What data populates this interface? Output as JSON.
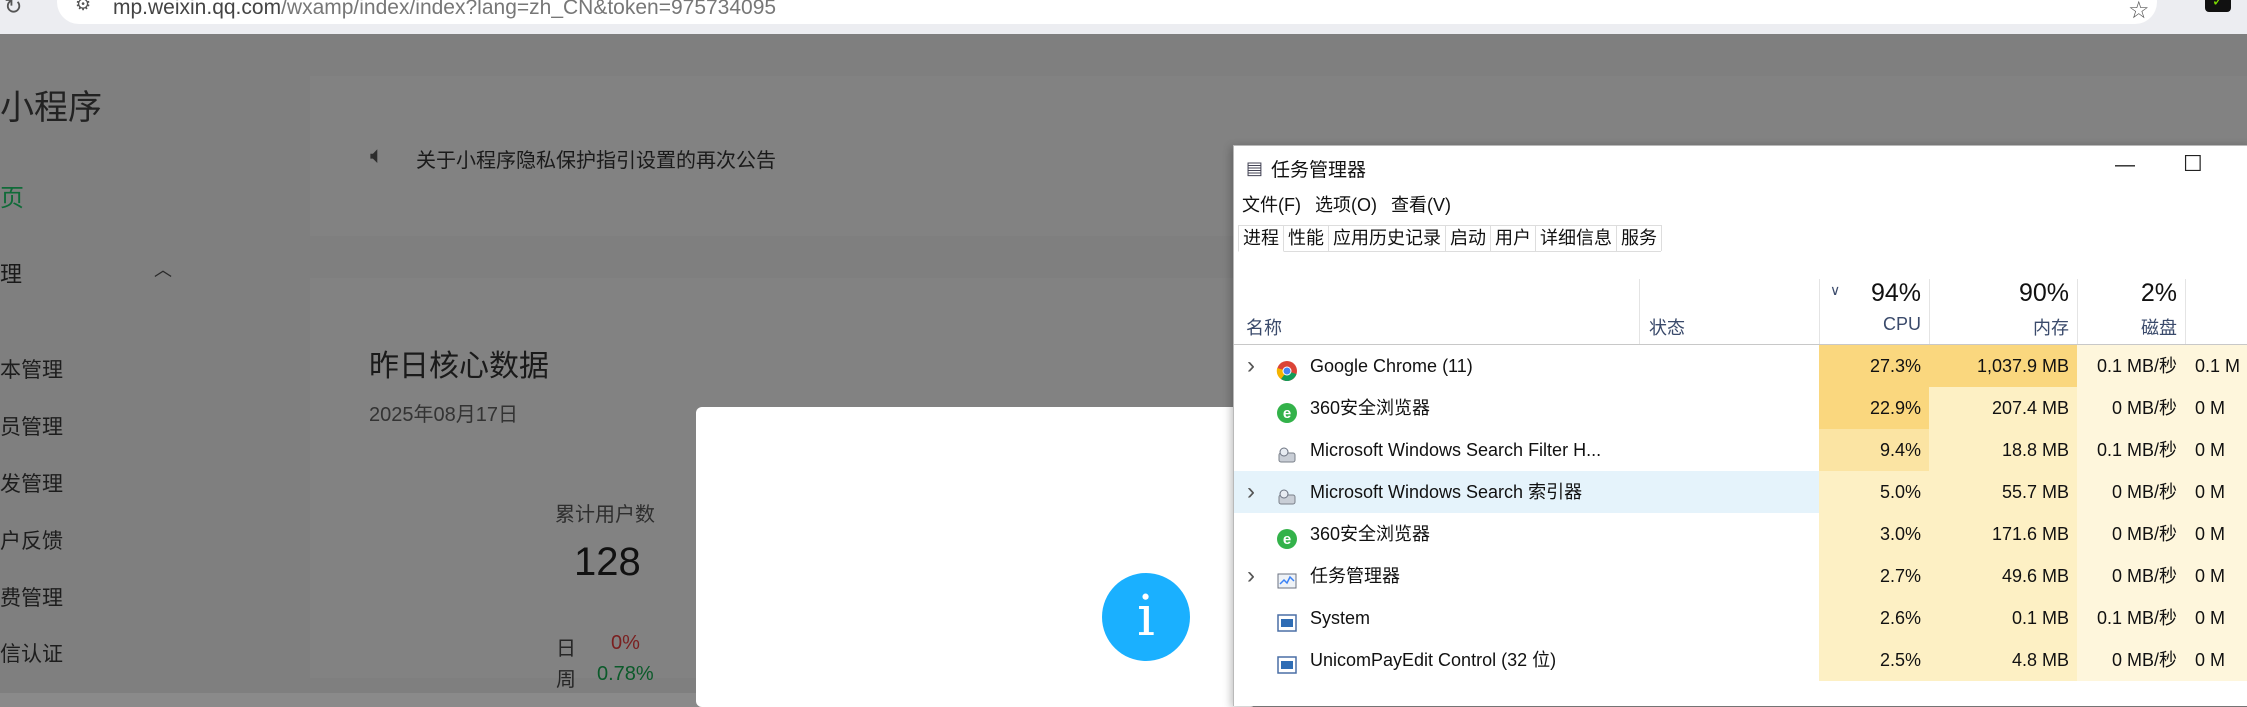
{
  "browser": {
    "url_host": "mp.weixin.qq.com",
    "url_path": "/wxamp/index/index?lang=zh_CN&token=975734095"
  },
  "page": {
    "brand": "小程序",
    "sidebar": {
      "home": "页",
      "group": "理",
      "items": [
        "本管理",
        "员管理",
        "发管理",
        "户反馈",
        "费管理",
        "信认证"
      ]
    },
    "notice": "关于小程序隐私保护指引设置的再次公告",
    "core": {
      "title": "昨日核心数据",
      "date": "2025年08月17日",
      "stat_label": "累计用户数",
      "stat_value": "128",
      "day_label": "日",
      "day_value": "0%",
      "week_label": "周",
      "week_value": "0.78%"
    }
  },
  "modal": {
    "icon": "i"
  },
  "taskmgr": {
    "title": "任务管理器",
    "menu": [
      "文件(F)",
      "选项(O)",
      "查看(V)"
    ],
    "tabs": [
      "进程",
      "性能",
      "应用历史记录",
      "启动",
      "用户",
      "详细信息",
      "服务"
    ],
    "headers": {
      "name": "名称",
      "status": "状态",
      "cpu_pct": "94%",
      "cpu": "CPU",
      "mem_pct": "90%",
      "mem": "内存",
      "disk_pct": "2%",
      "disk": "磁盘"
    },
    "processes": [
      {
        "name": "Google Chrome (11)",
        "cpu": "27.3%",
        "mem": "1,037.9 MB",
        "disk": "0.1 MB/秒",
        "net": "0.1 M",
        "expandable": true,
        "icon": "chrome-icon"
      },
      {
        "name": "360安全浏览器",
        "cpu": "22.9%",
        "mem": "207.4 MB",
        "disk": "0 MB/秒",
        "net": "0 M",
        "expandable": false,
        "icon": "360-browser-icon"
      },
      {
        "name": "Microsoft Windows Search Filter H...",
        "cpu": "9.4%",
        "mem": "18.8 MB",
        "disk": "0.1 MB/秒",
        "net": "0 M",
        "expandable": false,
        "icon": "search-indexer-icon"
      },
      {
        "name": "Microsoft Windows Search 索引器",
        "cpu": "5.0%",
        "mem": "55.7 MB",
        "disk": "0 MB/秒",
        "net": "0 M",
        "expandable": true,
        "icon": "search-indexer-icon"
      },
      {
        "name": "360安全浏览器",
        "cpu": "3.0%",
        "mem": "171.6 MB",
        "disk": "0 MB/秒",
        "net": "0 M",
        "expandable": false,
        "icon": "360-browser-icon"
      },
      {
        "name": "任务管理器",
        "cpu": "2.7%",
        "mem": "49.6 MB",
        "disk": "0 MB/秒",
        "net": "0 M",
        "expandable": true,
        "icon": "task-manager-icon"
      },
      {
        "name": "System",
        "cpu": "2.6%",
        "mem": "0.1 MB",
        "disk": "0.1 MB/秒",
        "net": "0 M",
        "expandable": false,
        "icon": "system-icon"
      },
      {
        "name": "UnicomPayEdit Control (32 位)",
        "cpu": "2.5%",
        "mem": "4.8 MB",
        "disk": "0 MB/秒",
        "net": "0 M",
        "expandable": false,
        "icon": "system-icon"
      }
    ],
    "colors": {
      "cpu_hot": "#fad77e",
      "cpu_warm": "#fbe4a3",
      "cpu_mild": "#fdf0c4",
      "mem_hot": "#fad77e",
      "mem_mild": "#fdf0c4",
      "disk": "#fef6dc",
      "selected": "#e5f3fb"
    }
  }
}
